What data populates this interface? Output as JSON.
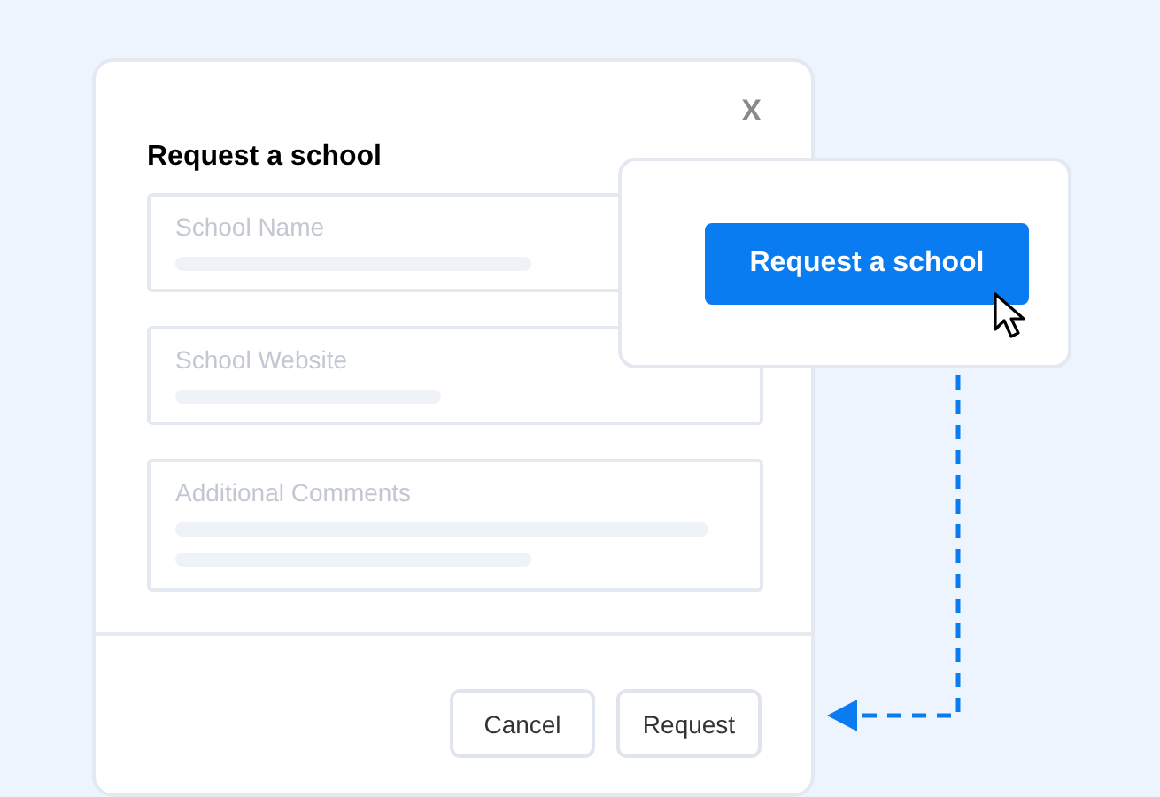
{
  "dialog": {
    "title": "Request a school",
    "close": "X",
    "fields": [
      {
        "kind": "text",
        "placeholder": "School Name"
      },
      {
        "kind": "text",
        "placeholder": "School Website"
      },
      {
        "kind": "textarea",
        "placeholder": "Additional Comments"
      }
    ],
    "buttons": [
      "Cancel",
      "Request"
    ]
  },
  "popup": {
    "button": "Request a school"
  }
}
